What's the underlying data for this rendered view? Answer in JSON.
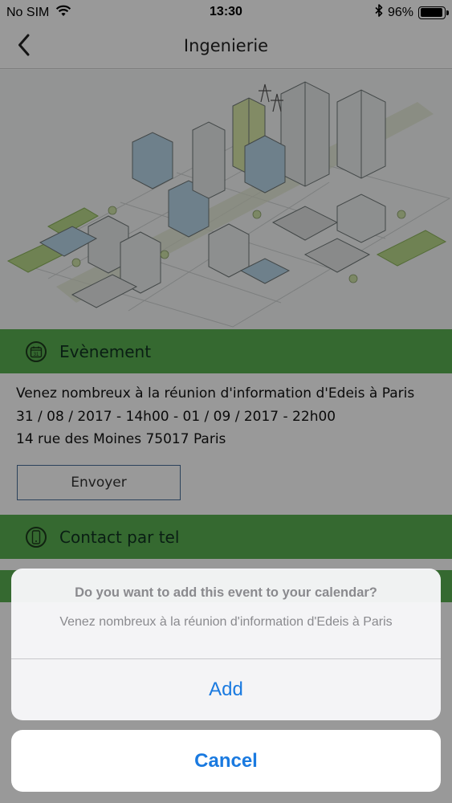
{
  "status_bar": {
    "carrier": "No SIM",
    "time": "13:30",
    "battery": "96%",
    "battery_level": 0.96,
    "icons": [
      "wifi-icon",
      "bluetooth-icon",
      "battery-icon"
    ]
  },
  "nav": {
    "title": "Ingenierie",
    "back_icon": "chevron-left-icon"
  },
  "hero": {
    "image": "isometric-city-illustration"
  },
  "event_section": {
    "icon": "calendar-icon",
    "icon_text": "31",
    "title": "Evènement",
    "line1": "Venez nombreux à la réunion d'information d'Edeis à Paris",
    "line2": "31 / 08 / 2017 - 14h00 - 01 / 09 / 2017 - 22h00",
    "line3": "14 rue des Moines 75017 Paris",
    "send_label": "Envoyer"
  },
  "contact_section": {
    "icon": "phone-icon",
    "title": "Contact par tel"
  },
  "action_sheet": {
    "title": "Do you want to add this event to your calendar?",
    "message": "Venez nombreux à la réunion d'information d'Edeis à Paris",
    "add_label": "Add",
    "cancel_label": "Cancel"
  },
  "colors": {
    "section_green": "#59b050",
    "ios_blue": "#1a7ae0",
    "button_border": "#4a6e9a"
  }
}
